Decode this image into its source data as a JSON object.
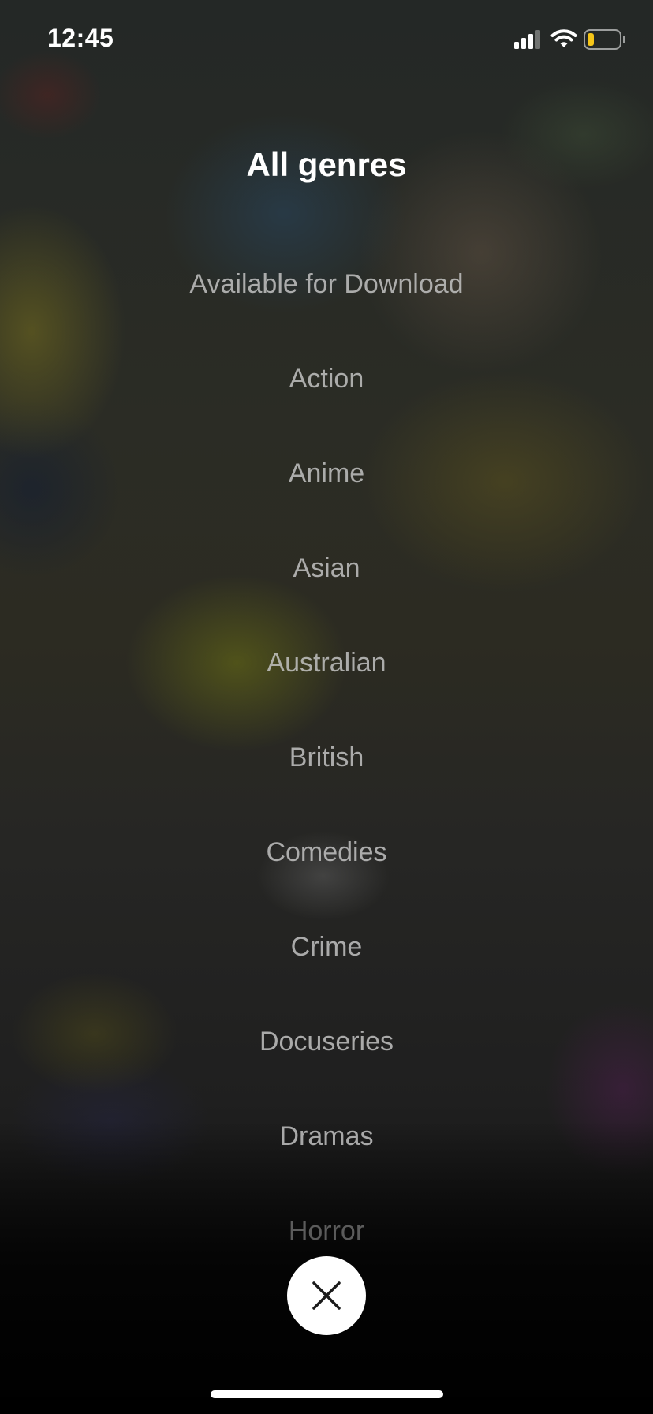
{
  "status_bar": {
    "time": "12:45",
    "icons": [
      "cellular-signal-icon",
      "wifi-icon",
      "battery-icon"
    ],
    "battery_color": "#f5c518"
  },
  "page": {
    "title": "All genres"
  },
  "genres": [
    {
      "label": "Available for Download"
    },
    {
      "label": "Action"
    },
    {
      "label": "Anime"
    },
    {
      "label": "Asian"
    },
    {
      "label": "Australian"
    },
    {
      "label": "British"
    },
    {
      "label": "Comedies"
    },
    {
      "label": "Crime"
    },
    {
      "label": "Docuseries"
    },
    {
      "label": "Dramas"
    },
    {
      "label": "Horror"
    }
  ],
  "close_button": {
    "icon": "close-icon"
  },
  "colors": {
    "text_primary": "#ffffff",
    "text_item": "#c8c8c8",
    "button_bg": "#ffffff"
  }
}
